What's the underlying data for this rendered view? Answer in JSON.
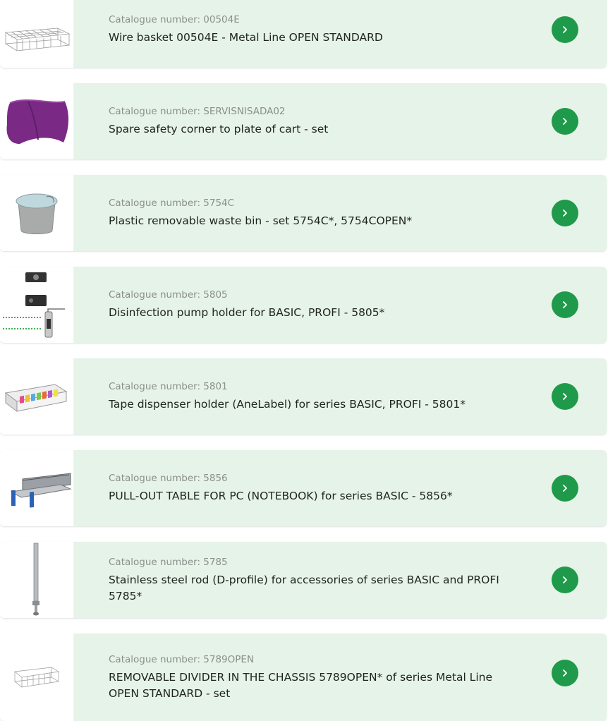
{
  "colors": {
    "card_bg": "#e6f3e8",
    "button": "#1f9a4a",
    "catalogue_text": "#8b8f8b",
    "title_text": "#1f241f"
  },
  "icons": {
    "arrow": "chevron-right-icon"
  },
  "items": [
    {
      "catalogue": "Catalogue number: 00504E",
      "title": "Wire basket 00504E - Metal Line OPEN STANDARD",
      "image": "wire-basket"
    },
    {
      "catalogue": "Catalogue number: SERVISNISADA02",
      "title": "Spare safety corner to plate of cart - set",
      "image": "safety-corner"
    },
    {
      "catalogue": "Catalogue number: 5754C",
      "title": "Plastic removable waste bin - set 5754C*, 5754COPEN*",
      "image": "waste-bin"
    },
    {
      "catalogue": "Catalogue number: 5805",
      "title": "Disinfection pump holder for BASIC, PROFI - 5805*",
      "image": "pump-holder"
    },
    {
      "catalogue": "Catalogue number: 5801",
      "title": "Tape dispenser holder (AneLabel) for series BASIC, PROFI - 5801*",
      "image": "tape-dispenser"
    },
    {
      "catalogue": "Catalogue number: 5856",
      "title": "PULL-OUT TABLE FOR PC (NOTEBOOK) for series BASIC - 5856*",
      "image": "pull-out-table"
    },
    {
      "catalogue": "Catalogue number: 5785",
      "title": "Stainless steel rod (D-profile) for accessories of series BASIC and PROFI 5785*",
      "image": "steel-rod"
    },
    {
      "catalogue": "Catalogue number: 5789OPEN",
      "title": "REMOVABLE DIVIDER IN THE CHASSIS 5789OPEN* of series Metal Line OPEN STANDARD - set",
      "image": "divider"
    }
  ]
}
